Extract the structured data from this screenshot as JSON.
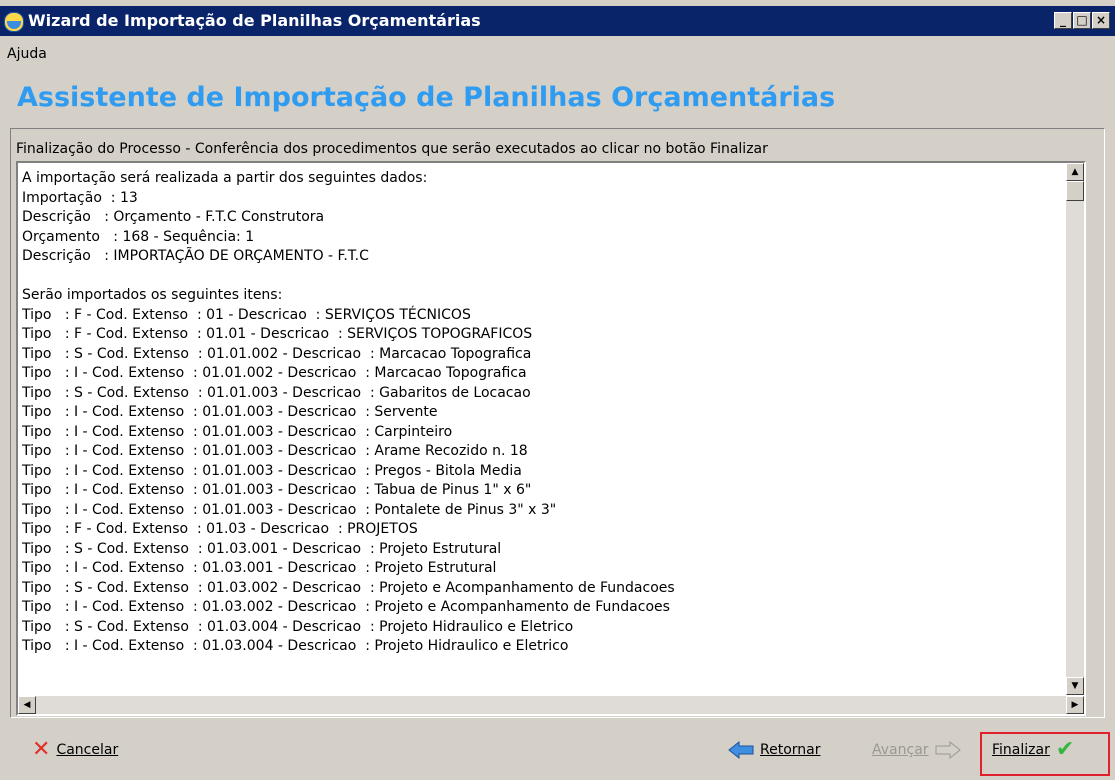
{
  "window": {
    "title": "Wizard de Importação de Planilhas Orçamentárias"
  },
  "menu": {
    "help": "Ajuda"
  },
  "heading": "Assistente de Importação de Planilhas Orçamentárias",
  "panel": {
    "label": "Finalização do Processo - Conferência dos procedimentos que serão executados ao clicar no botão Finalizar",
    "lines": [
      "A importação será realizada a partir dos seguintes dados:",
      "Importação  : 13",
      "Descrição   : Orçamento - F.T.C Construtora",
      "Orçamento   : 168 - Sequência: 1",
      "Descrição   : IMPORTAÇÃO DE ORÇAMENTO - F.T.C",
      "",
      "Serão importados os seguintes itens:",
      "Tipo   : F - Cod. Extenso  : 01 - Descricao  : SERVIÇOS TÉCNICOS",
      "Tipo   : F - Cod. Extenso  : 01.01 - Descricao  : SERVIÇOS TOPOGRAFICOS",
      "Tipo   : S - Cod. Extenso  : 01.01.002 - Descricao  : Marcacao Topografica",
      "Tipo   : I - Cod. Extenso  : 01.01.002 - Descricao  : Marcacao Topografica",
      "Tipo   : S - Cod. Extenso  : 01.01.003 - Descricao  : Gabaritos de Locacao",
      "Tipo   : I - Cod. Extenso  : 01.01.003 - Descricao  : Servente",
      "Tipo   : I - Cod. Extenso  : 01.01.003 - Descricao  : Carpinteiro",
      "Tipo   : I - Cod. Extenso  : 01.01.003 - Descricao  : Arame Recozido n. 18",
      "Tipo   : I - Cod. Extenso  : 01.01.003 - Descricao  : Pregos - Bitola Media",
      "Tipo   : I - Cod. Extenso  : 01.01.003 - Descricao  : Tabua de Pinus 1\" x 6\"",
      "Tipo   : I - Cod. Extenso  : 01.01.003 - Descricao  : Pontalete de Pinus 3\" x 3\"",
      "Tipo   : F - Cod. Extenso  : 01.03 - Descricao  : PROJETOS",
      "Tipo   : S - Cod. Extenso  : 01.03.001 - Descricao  : Projeto Estrutural",
      "Tipo   : I - Cod. Extenso  : 01.03.001 - Descricao  : Projeto Estrutural",
      "Tipo   : S - Cod. Extenso  : 01.03.002 - Descricao  : Projeto e Acompanhamento de Fundacoes",
      "Tipo   : I - Cod. Extenso  : 01.03.002 - Descricao  : Projeto e Acompanhamento de Fundacoes",
      "Tipo   : S - Cod. Extenso  : 01.03.004 - Descricao  : Projeto Hidraulico e Eletrico",
      "Tipo   : I - Cod. Extenso  : 01.03.004 - Descricao  : Projeto Hidraulico e Eletrico"
    ]
  },
  "footer": {
    "cancel": "Cancelar",
    "back": "Retornar",
    "next": "Avançar",
    "finish": "Finalizar"
  },
  "icons": {
    "cancel": "x-icon",
    "back": "arrow-left-icon",
    "next": "arrow-right-icon",
    "finish": "check-icon"
  },
  "colors": {
    "titlebar": "#0a246a",
    "heading": "#2f9bf1",
    "highlight": "#e0202a",
    "check": "#34b640",
    "cancel": "#e0302a"
  }
}
